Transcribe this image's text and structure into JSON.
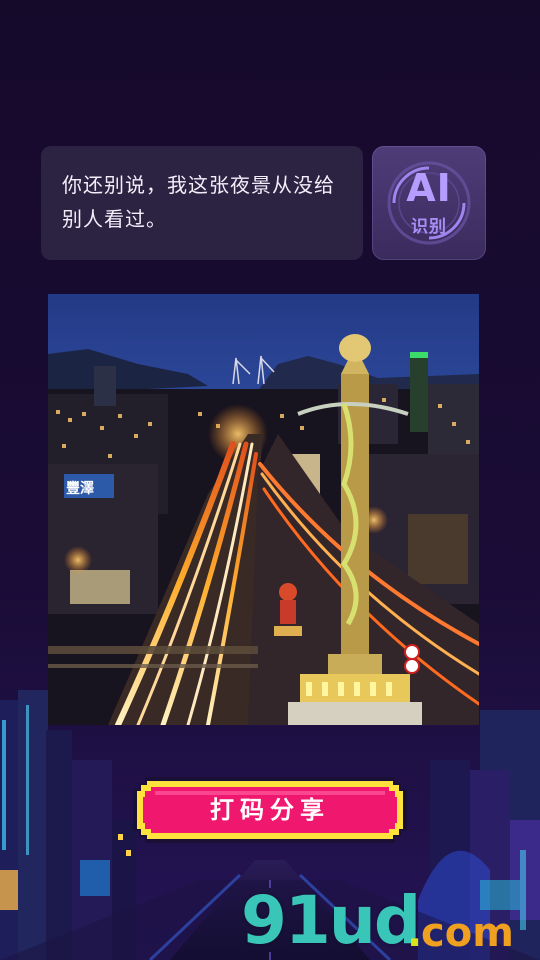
{
  "chat": {
    "message": "你还别说，我这张夜景从没给别人看过。"
  },
  "ai_badge": {
    "title": "AI",
    "subtitle": "识别"
  },
  "photo": {
    "description_icon": "night-city-photo",
    "sign_text": "豐澤"
  },
  "share_button": {
    "label": "打码分享"
  },
  "watermark": {
    "main": "91ud",
    "dot": ".",
    "suffix": "com"
  },
  "colors": {
    "background": "#17082d",
    "bubble": "#2c2342",
    "button_fill": "#f0186e",
    "button_border": "#1a0f35",
    "button_frame": "#ffe23c",
    "ai_text": "#b59cff"
  }
}
